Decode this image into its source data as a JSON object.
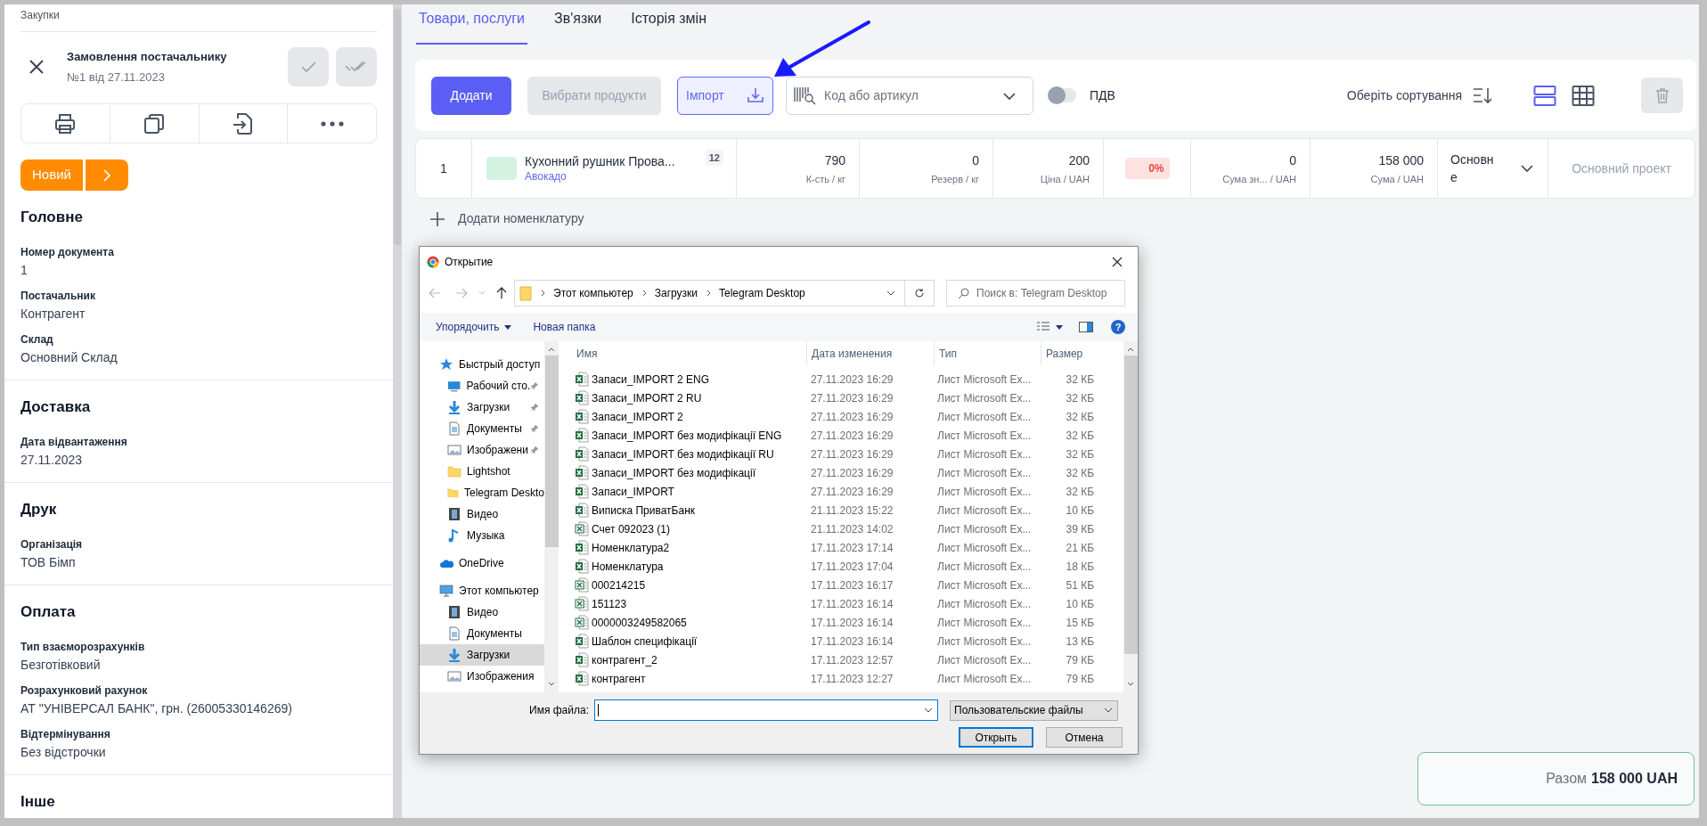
{
  "sidebar": {
    "breadcrumb": "Закупки",
    "title": "Замовлення постачальнику",
    "subtitle": "№1 від 27.11.2023",
    "status": "Новий",
    "sections": [
      {
        "heading": "Головне",
        "fields": [
          {
            "label": "Номер документа",
            "value": "1"
          },
          {
            "label": "Постачальник",
            "value": "Контрагент"
          },
          {
            "label": "Склад",
            "value": "Основний Склад"
          }
        ]
      },
      {
        "heading": "Доставка",
        "fields": [
          {
            "label": "Дата відвантаження",
            "value": "27.11.2023"
          }
        ]
      },
      {
        "heading": "Друк",
        "fields": [
          {
            "label": "Організація",
            "value": "ТОВ Бімп"
          }
        ]
      },
      {
        "heading": "Оплата",
        "fields": [
          {
            "label": "Тип взаєморозрахунків",
            "value": "Безготівковий"
          },
          {
            "label": "Розрахунковий рахунок",
            "value": "АТ \"УНІВЕРСАЛ БАНК\", грн. (26005330146269)"
          },
          {
            "label": "Відтермінування",
            "value": "Без відстрочки"
          }
        ]
      },
      {
        "heading": "Інше"
      }
    ]
  },
  "tabs": [
    {
      "label": "Товари, послуги",
      "selected": true
    },
    {
      "label": "Зв'язки",
      "selected": false
    },
    {
      "label": "Історія змін",
      "selected": false
    }
  ],
  "toolbar": {
    "add_button": "Додати",
    "choose_button": "Вибрати продукти",
    "import_button": "Імпорт",
    "search": {
      "placeholder": "Код або артикул"
    },
    "vat": {
      "label": "ПДВ",
      "on": false
    },
    "sort_label": "Оберіть сортування",
    "views": [
      {
        "kind": "rows",
        "selected": true
      },
      {
        "kind": "grid",
        "selected": false
      }
    ]
  },
  "rows": [
    {
      "number": "1",
      "color": "#d3f2e1",
      "name": "Кухонний рушник Прова...",
      "variant": "Авокадо",
      "badge": "12",
      "cells": [
        {
          "kind": "number",
          "value": "790",
          "caption": "К-сть / кг"
        },
        {
          "kind": "number",
          "value": "0",
          "caption": "Резерв / кг"
        },
        {
          "kind": "number",
          "value": "200",
          "caption": "Ціна / UAH"
        },
        {
          "kind": "discount",
          "value": "0%"
        },
        {
          "kind": "number",
          "value": "0",
          "caption": "Сума зн... / UAH"
        },
        {
          "kind": "number",
          "value": "158 000",
          "caption": "Сума / UAH"
        },
        {
          "kind": "select",
          "value": "Основне"
        },
        {
          "kind": "project",
          "placeholder": "Основний проект"
        }
      ]
    }
  ],
  "add_item": "Додати номенклатуру",
  "total": {
    "label": "Разом",
    "value": "158 000 UAH"
  },
  "dialog": {
    "title": "Открытие",
    "path": [
      "Этот компьютер",
      "Загрузки",
      "Telegram Desktop"
    ],
    "search_placeholder": "Поиск в: Telegram Desktop",
    "organize": "Упорядочить",
    "new_folder": "Новая папка",
    "help": "?",
    "nav": [
      {
        "label": "Быстрый доступ",
        "kind": "star",
        "pinned": false,
        "selected": false,
        "children": [
          {
            "label": "Рабочий сто.",
            "kind": "desktop",
            "pinned": true,
            "selected": false
          },
          {
            "label": "Загрузки",
            "kind": "download",
            "pinned": true,
            "selected": false
          },
          {
            "label": "Документы",
            "kind": "document",
            "pinned": true,
            "selected": false
          },
          {
            "label": "Изображени",
            "kind": "image",
            "pinned": true,
            "selected": false
          },
          {
            "label": "Lightshot",
            "kind": "folder",
            "pinned": false,
            "selected": false
          },
          {
            "label": "Telegram Deskto",
            "kind": "folder",
            "pinned": false,
            "selected": false
          },
          {
            "label": "Видео",
            "kind": "video",
            "pinned": false,
            "selected": false
          },
          {
            "label": "Музыка",
            "kind": "music",
            "pinned": false,
            "selected": false
          }
        ]
      },
      {
        "label": "OneDrive",
        "kind": "cloud",
        "pinned": false,
        "selected": false
      },
      {
        "label": "Этот компьютер",
        "kind": "computer",
        "pinned": false,
        "selected": false,
        "children": [
          {
            "label": "Видео",
            "kind": "video",
            "pinned": false,
            "selected": false
          },
          {
            "label": "Документы",
            "kind": "document",
            "pinned": false,
            "selected": false
          },
          {
            "label": "Загрузки",
            "kind": "download",
            "pinned": false,
            "selected": true
          },
          {
            "label": "Изображения",
            "kind": "image",
            "pinned": false,
            "selected": false
          }
        ]
      }
    ],
    "columns": [
      "Имя",
      "Дата изменения",
      "Тип",
      "Размер"
    ],
    "files": [
      {
        "kind": "xlsx",
        "name": "Запаси_IMPORT 2 ENG",
        "date": "27.11.2023 16:29",
        "type": "Лист Microsoft Ex...",
        "size": "32 КБ"
      },
      {
        "kind": "xlsx",
        "name": "Запаси_IMPORT 2 RU",
        "date": "27.11.2023 16:29",
        "type": "Лист Microsoft Ex...",
        "size": "32 КБ"
      },
      {
        "kind": "xlsx",
        "name": "Запаси_IMPORT 2",
        "date": "27.11.2023 16:29",
        "type": "Лист Microsoft Ex...",
        "size": "32 КБ"
      },
      {
        "kind": "xlsx",
        "name": "Запаси_IMPORT без модифікації ENG",
        "date": "27.11.2023 16:29",
        "type": "Лист Microsoft Ex...",
        "size": "32 КБ"
      },
      {
        "kind": "xlsx",
        "name": "Запаси_IMPORT без модифікації RU",
        "date": "27.11.2023 16:29",
        "type": "Лист Microsoft Ex...",
        "size": "32 КБ"
      },
      {
        "kind": "xlsx",
        "name": "Запаси_IMPORT без модифікації",
        "date": "27.11.2023 16:29",
        "type": "Лист Microsoft Ex...",
        "size": "32 КБ"
      },
      {
        "kind": "xlsx",
        "name": "Запаси_IMPORT",
        "date": "27.11.2023 16:29",
        "type": "Лист Microsoft Ex...",
        "size": "32 КБ"
      },
      {
        "kind": "xlsx",
        "name": "Виписка ПриватБанк",
        "date": "21.11.2023 15:22",
        "type": "Лист Microsoft Ex...",
        "size": "10 КБ"
      },
      {
        "kind": "xls",
        "name": "Счет 092023 (1)",
        "date": "21.11.2023 14:02",
        "type": "Лист Microsoft Ex...",
        "size": "39 КБ"
      },
      {
        "kind": "xlsx",
        "name": "Номенклатура2",
        "date": "17.11.2023 17:14",
        "type": "Лист Microsoft Ex...",
        "size": "21 КБ"
      },
      {
        "kind": "xlsx",
        "name": "Номенклатура",
        "date": "17.11.2023 17:04",
        "type": "Лист Microsoft Ex...",
        "size": "18 КБ"
      },
      {
        "kind": "xls",
        "name": "000214215",
        "date": "17.11.2023 16:17",
        "type": "Лист Microsoft Ex...",
        "size": "51 КБ"
      },
      {
        "kind": "xls",
        "name": "151123",
        "date": "17.11.2023 16:14",
        "type": "Лист Microsoft Ex...",
        "size": "10 КБ"
      },
      {
        "kind": "xls",
        "name": "0000003249582065",
        "date": "17.11.2023 16:14",
        "type": "Лист Microsoft Ex...",
        "size": "15 КБ"
      },
      {
        "kind": "xlsx",
        "name": "Шаблон специфікації",
        "date": "17.11.2023 16:14",
        "type": "Лист Microsoft Ex...",
        "size": "13 КБ"
      },
      {
        "kind": "xlsx",
        "name": "контрагент_2",
        "date": "17.11.2023 12:57",
        "type": "Лист Microsoft Ex...",
        "size": "79 КБ"
      },
      {
        "kind": "xlsx",
        "name": "контрагент",
        "date": "17.11.2023 12:27",
        "type": "Лист Microsoft Ex...",
        "size": "79 КБ"
      }
    ],
    "filename_label": "Имя файла:",
    "filter": "Пользовательские файлы",
    "open_button": "Открыть",
    "cancel_button": "Отмена"
  }
}
